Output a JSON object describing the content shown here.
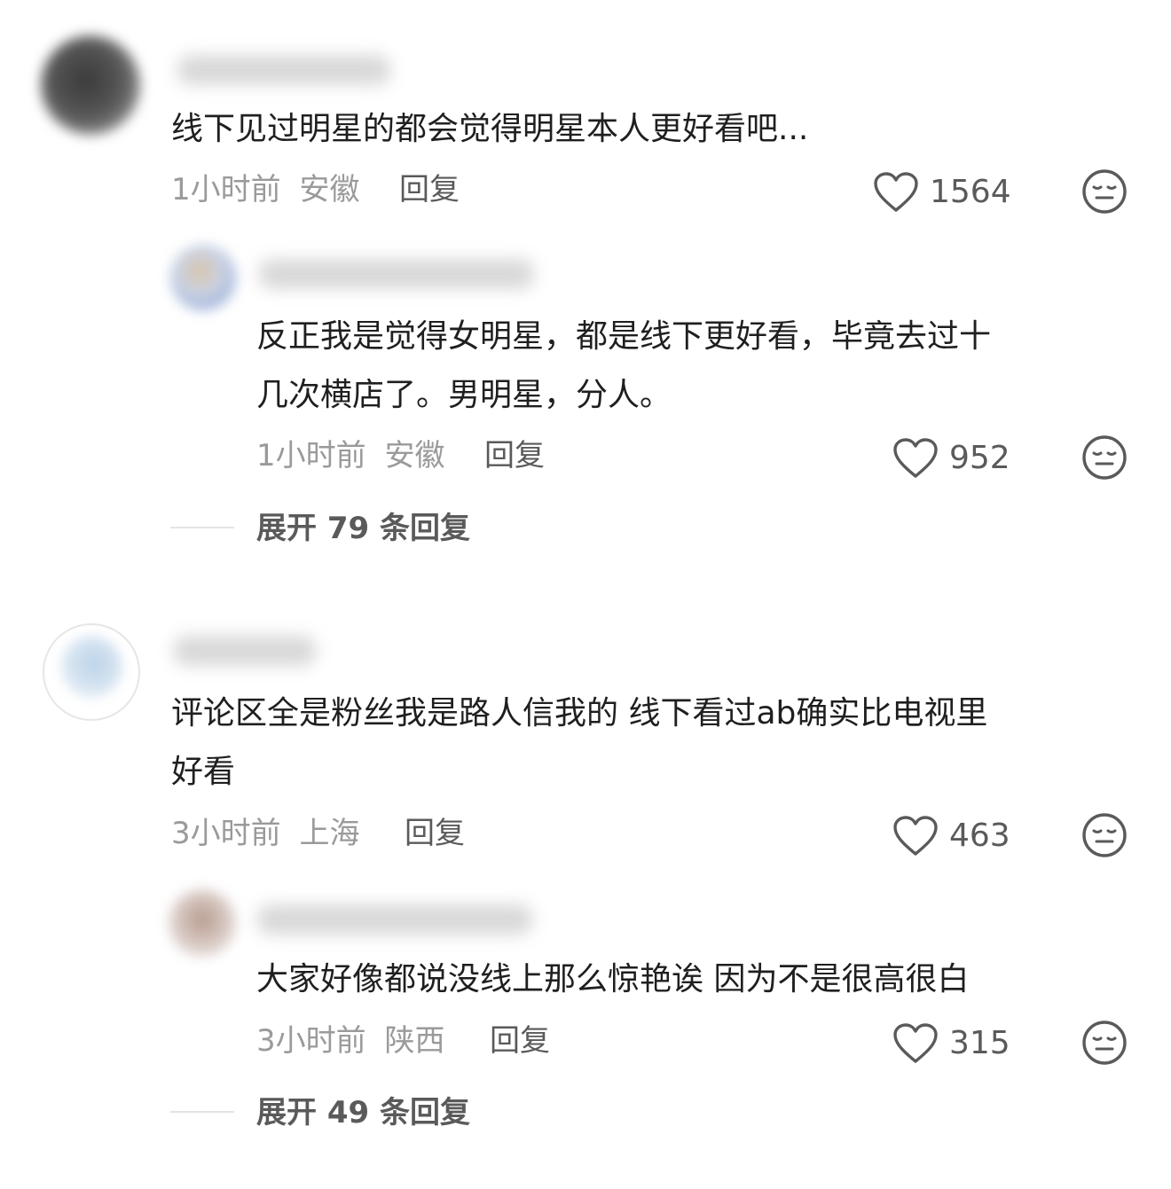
{
  "comments": [
    {
      "content": "线下见过明星的都会觉得明星本人更好看吧...",
      "time": "1小时前",
      "location": "安徽",
      "reply_label": "回复",
      "likes": "1564",
      "replies": [
        {
          "content": "反正我是觉得女明星，都是线下更好看，毕竟去过十\n几次横店了。男明星，分人。",
          "time": "1小时前",
          "location": "安徽",
          "reply_label": "回复",
          "likes": "952"
        }
      ],
      "expand_label": "展开 79 条回复"
    },
    {
      "content": "评论区全是粉丝我是路人信我的 线下看过ab确实比电视里\n好看",
      "time": "3小时前",
      "location": "上海",
      "reply_label": "回复",
      "likes": "463",
      "replies": [
        {
          "content": "大家好像都说没线上那么惊艳诶 因为不是很高很白",
          "time": "3小时前",
          "location": "陕西",
          "reply_label": "回复",
          "likes": "315"
        }
      ],
      "expand_label": "展开 49 条回复"
    }
  ],
  "icons": {
    "like": "heart-outline-icon",
    "dislike": "neutral-face-icon"
  },
  "colors": {
    "meta_text": "#9a9a9a",
    "body_text": "#1f1f1f",
    "icon_stroke": "#5a5a5a"
  }
}
